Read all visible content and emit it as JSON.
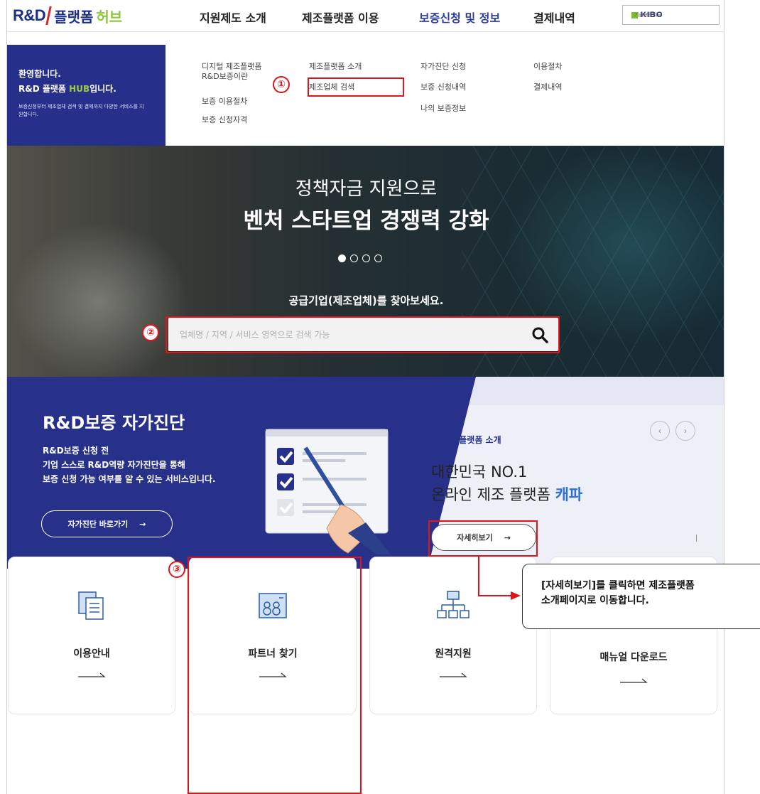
{
  "header": {
    "logo": {
      "rd": "R&D",
      "platform": "플랫폼",
      "hub": "허브"
    },
    "nav": [
      "지원제도 소개",
      "제조플랫폼 이용",
      "보증신청 및 정보",
      "결제내역"
    ],
    "active_nav": "보증신청 및 정보",
    "kibo": {
      "name": "KIBO",
      "sub": "기술보증기금"
    }
  },
  "welcome": {
    "line1": "환영합니다.",
    "line2_prefix": "R&D 플랫폼 ",
    "line2_hub": "HUB",
    "line2_suffix": "입니다.",
    "desc": "보증신청부터 제조업체 검색 및 결제까지 다양한 서비스를 지원합니다."
  },
  "submenu": {
    "col1": [
      "디지털 제조플랫폼",
      "R&D보증이란",
      "보증 이용절차",
      "보증 신청자격"
    ],
    "col2": [
      "제조플랫폼 소개",
      "제조업체 검색"
    ],
    "col3": [
      "자가진단 신청",
      "보증 신청내역",
      "나의 보증정보"
    ],
    "col4": [
      "이용절차",
      "결제내역"
    ]
  },
  "hero": {
    "line1": "정책자금 지원으로",
    "line2": "벤처 스타트업 경쟁력 강화",
    "slides": 4,
    "active_slide": 1,
    "question": "공급기업(제조업체)를 찾아보세요.",
    "search_placeholder": "업체명 / 지역 / 서비스 영역으로 검색 가능"
  },
  "self_diagnosis": {
    "title": "R&D보증 자가진단",
    "desc": [
      "R&D보증 신청 전",
      "기업 스스로 R&D역량 자가진단을 통해",
      "보증 신청 가능 여부를 알 수 있는 서비스입니다."
    ],
    "button": "자가진단 바로가기",
    "arrow": "→"
  },
  "capa": {
    "label": "CAPA 플랫폼 소개",
    "line1": "대한민국 NO.1",
    "line2_prefix": "온라인 제조 플랫폼 ",
    "line2_highlight": "캐파",
    "button": "자세히보기",
    "arrow": "→",
    "prev": "‹",
    "next": "›"
  },
  "cards": [
    {
      "label": "이용안내",
      "icon": "document-icon"
    },
    {
      "label": "파트너 찾기",
      "icon": "partner-board-icon"
    },
    {
      "label": "원격지원",
      "icon": "network-icon"
    },
    {
      "label": "매뉴얼 다운로드",
      "icon": "cloud-download-icon"
    }
  ],
  "annotations": {
    "markers": [
      "①",
      "②",
      "③"
    ],
    "callout": [
      "[자세히보기]를 클릭하면 제조플랫폼",
      "소개페이지로 이동합니다."
    ],
    "colors": {
      "annotation": "#e0141b",
      "brand": "#27318a",
      "accent": "#9ccb3b"
    }
  }
}
